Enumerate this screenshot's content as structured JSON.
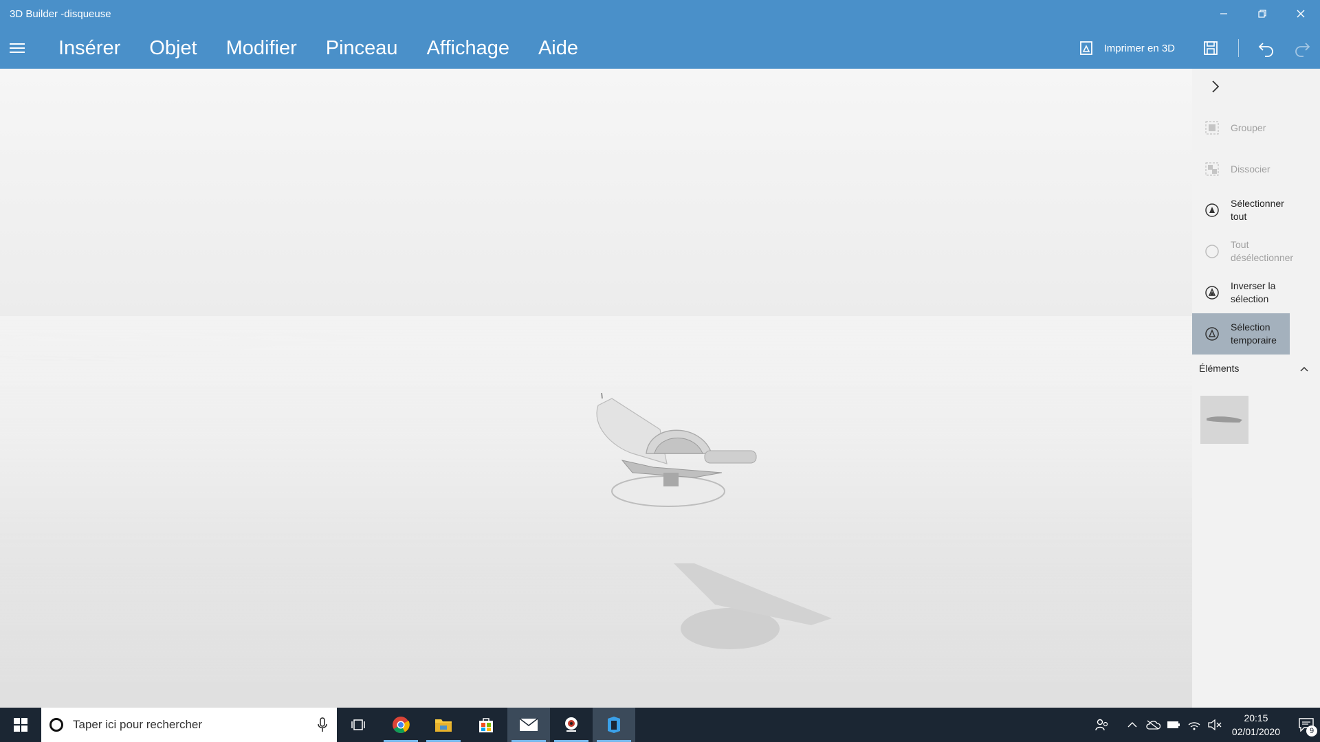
{
  "window": {
    "title": "3D Builder -disqueuse",
    "controls": [
      "minimize-icon",
      "restore-icon",
      "close-icon"
    ]
  },
  "menu": {
    "items": [
      "Insérer",
      "Objet",
      "Modifier",
      "Pinceau",
      "Affichage",
      "Aide"
    ],
    "print3d_label": "Imprimer en 3D"
  },
  "panel": {
    "actions": [
      {
        "label": "Grouper",
        "icon": "group-icon",
        "enabled": false
      },
      {
        "label": "Dissocier",
        "icon": "ungroup-icon",
        "enabled": false
      },
      {
        "label": "Sélectionner tout",
        "icon": "select-all-icon",
        "enabled": true
      },
      {
        "label": "Tout désélectionner",
        "icon": "deselect-all-icon",
        "enabled": false
      },
      {
        "label": "Inverser la sélection",
        "icon": "invert-selection-icon",
        "enabled": true
      },
      {
        "label": "Sélection temporaire",
        "icon": "temporary-selection-icon",
        "enabled": true,
        "active": true
      }
    ],
    "elements_label": "Éléments"
  },
  "taskbar": {
    "search_placeholder": "Taper ici pour rechercher",
    "apps": [
      "task-view-icon",
      "chrome-icon",
      "file-explorer-icon",
      "store-icon",
      "mail-icon",
      "webcam-app-icon",
      "3d-builder-icon"
    ],
    "time": "20:15",
    "date": "02/01/2020",
    "notification_count": "9"
  },
  "colors": {
    "accent": "#4a90c9",
    "taskbar": "#1b2633",
    "panel_active": "#a4b1bd"
  }
}
